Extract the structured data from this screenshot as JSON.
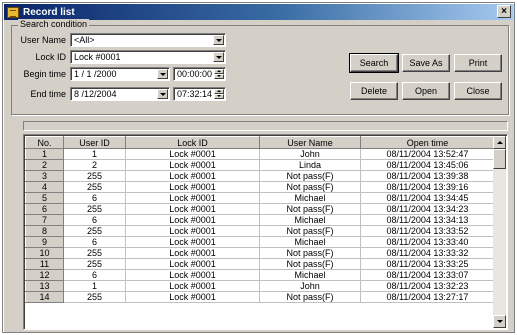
{
  "window": {
    "title": "Record list",
    "close_glyph": "×"
  },
  "search": {
    "legend": "Search condition",
    "user_name_label": "User Name",
    "user_name_value": "<All>",
    "lock_id_label": "Lock ID",
    "lock_id_value": "Lock #0001",
    "begin_time_label": "Begin time",
    "begin_date": "1 / 1 /2000",
    "begin_time": "00:00:00",
    "end_time_label": "End time",
    "end_date": "8 /12/2004",
    "end_time": "07:32:14"
  },
  "buttons": {
    "search": "Search",
    "save_as": "Save As",
    "print": "Print",
    "delete": "Delete",
    "open": "Open",
    "close": "Close"
  },
  "table": {
    "columns": [
      "No.",
      "User ID",
      "Lock ID",
      "User Name",
      "Open time"
    ],
    "rows": [
      [
        "1",
        "1",
        "Lock #0001",
        "John",
        "08/11/2004 13:52:47"
      ],
      [
        "2",
        "2",
        "Lock #0001",
        "Linda",
        "08/11/2004 13:45:06"
      ],
      [
        "3",
        "255",
        "Lock #0001",
        "Not pass(F)",
        "08/11/2004 13:39:38"
      ],
      [
        "4",
        "255",
        "Lock #0001",
        "Not pass(F)",
        "08/11/2004 13:39:16"
      ],
      [
        "5",
        "6",
        "Lock #0001",
        "Michael",
        "08/11/2004 13:34:45"
      ],
      [
        "6",
        "255",
        "Lock #0001",
        "Not pass(F)",
        "08/11/2004 13:34:23"
      ],
      [
        "7",
        "6",
        "Lock #0001",
        "Michael",
        "08/11/2004 13:34:13"
      ],
      [
        "8",
        "255",
        "Lock #0001",
        "Not pass(F)",
        "08/11/2004 13:33:52"
      ],
      [
        "9",
        "6",
        "Lock #0001",
        "Michael",
        "08/11/2004 13:33:40"
      ],
      [
        "10",
        "255",
        "Lock #0001",
        "Not pass(F)",
        "08/11/2004 13:33:32"
      ],
      [
        "11",
        "255",
        "Lock #0001",
        "Not pass(F)",
        "08/11/2004 13:33:25"
      ],
      [
        "12",
        "6",
        "Lock #0001",
        "Michael",
        "08/11/2004 13:33:07"
      ],
      [
        "13",
        "1",
        "Lock #0001",
        "John",
        "08/11/2004 13:32:23"
      ],
      [
        "14",
        "255",
        "Lock #0001",
        "Not pass(F)",
        "08/11/2004 13:27:17"
      ]
    ]
  },
  "colors": {
    "title_start": "#0a246a",
    "title_end": "#a6caf0",
    "face": "#d4d0c8"
  },
  "icons": {
    "app": "record-list-app-icon",
    "close": "close-icon"
  }
}
